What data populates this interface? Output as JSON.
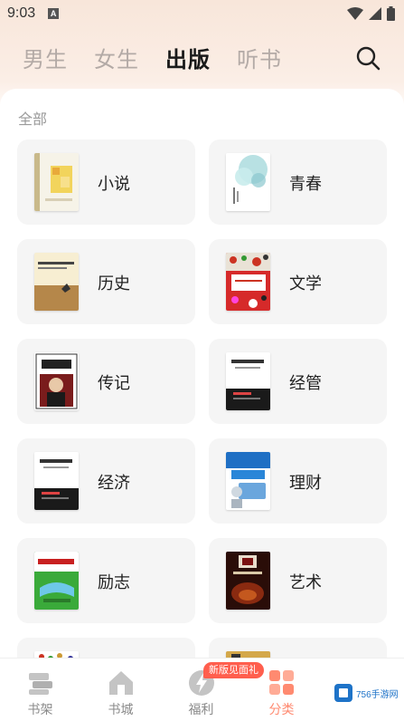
{
  "status_bar": {
    "time": "9:03",
    "notification_letter": "A"
  },
  "top_tabs": [
    {
      "label": "男生",
      "active": false
    },
    {
      "label": "女生",
      "active": false
    },
    {
      "label": "出版",
      "active": true
    },
    {
      "label": "听书",
      "active": false
    }
  ],
  "section": {
    "title": "全部"
  },
  "categories": [
    {
      "label": "小说"
    },
    {
      "label": "青春"
    },
    {
      "label": "历史"
    },
    {
      "label": "文学"
    },
    {
      "label": "传记"
    },
    {
      "label": "经管"
    },
    {
      "label": "经济"
    },
    {
      "label": "理财"
    },
    {
      "label": "励志"
    },
    {
      "label": "艺术"
    }
  ],
  "bottom_nav": [
    {
      "label": "书架",
      "icon": "bookshelf-icon",
      "active": false
    },
    {
      "label": "书城",
      "icon": "store-icon",
      "active": false
    },
    {
      "label": "福利",
      "icon": "lightning-icon",
      "active": false
    },
    {
      "label": "分类",
      "icon": "category-grid-icon",
      "active": true
    }
  ],
  "promo_badge": "新版见面礼",
  "watermark": "756手游网",
  "colors": {
    "accent": "#ff8a70",
    "badge": "#ff5e4d",
    "card_bg": "#f5f5f5"
  }
}
